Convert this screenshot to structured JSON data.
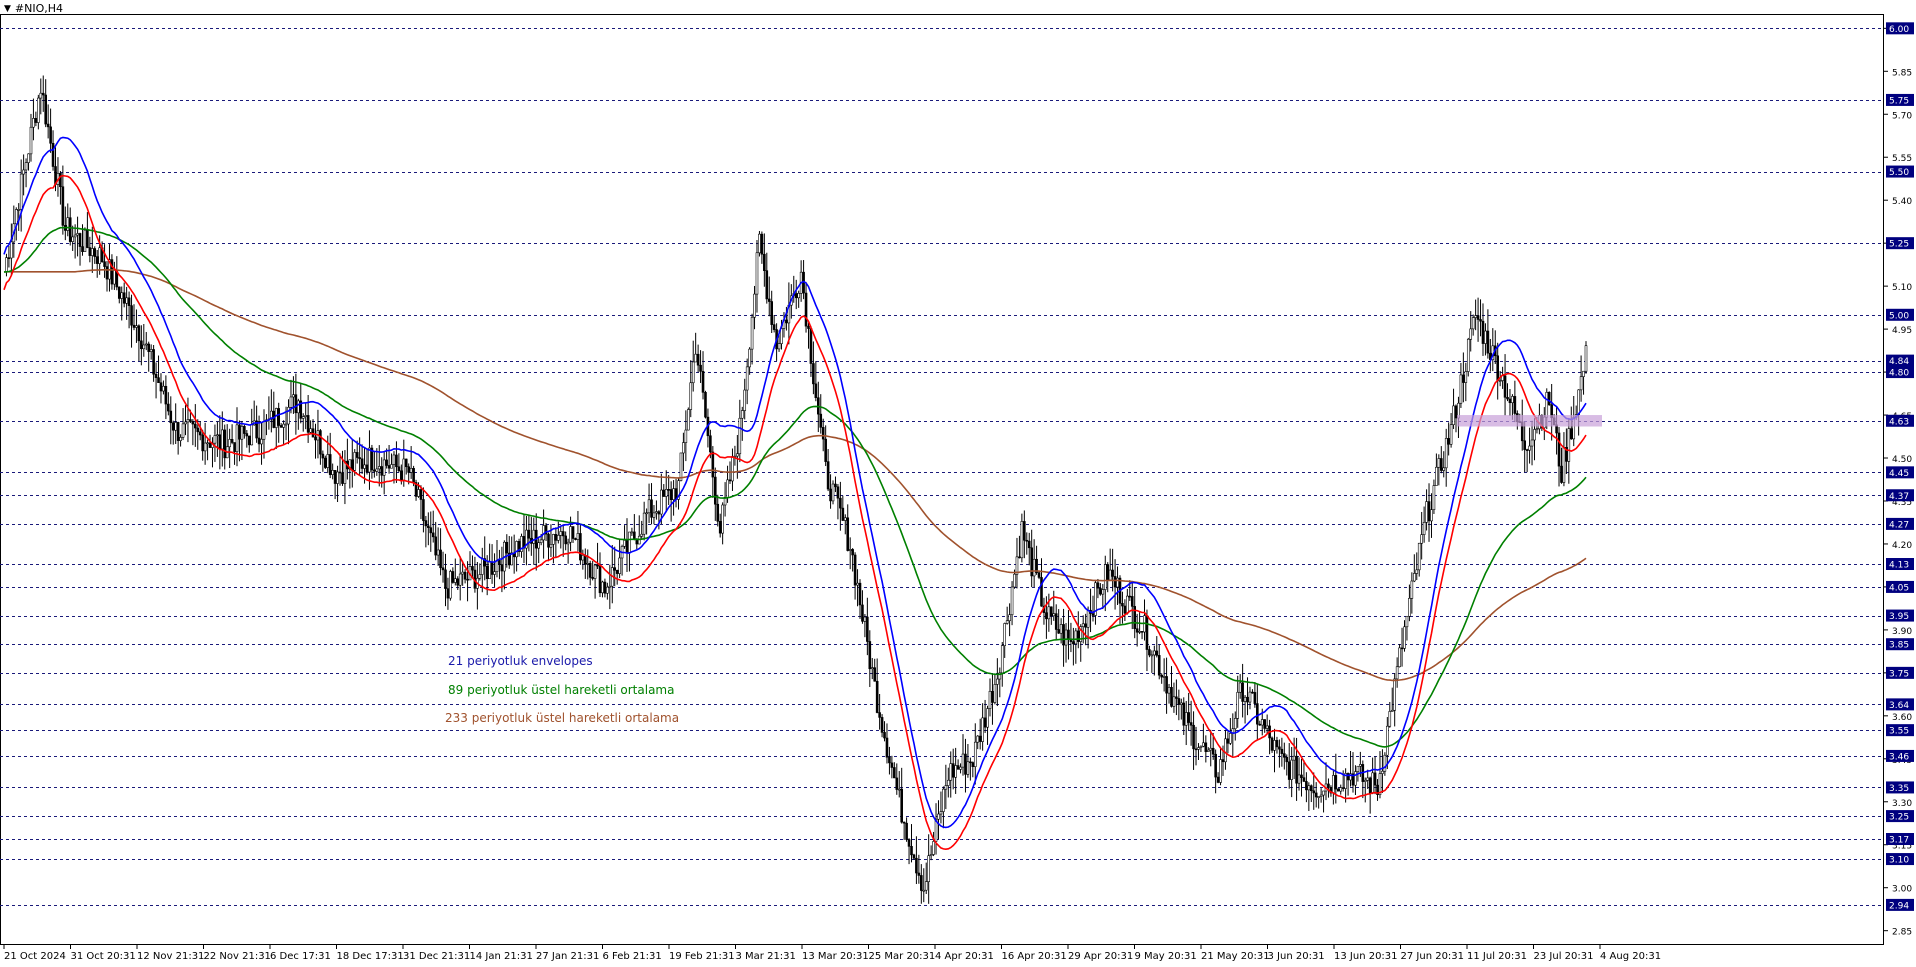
{
  "chart_title": "#NIO,H4",
  "colors": {
    "envelope_upper": "#0000ff",
    "envelope_lower": "#ff0000",
    "ema89": "#008000",
    "ema233": "#a0522d",
    "level_badge_bg": "#00007f",
    "level_badge_text": "#ffffff",
    "zone": "#c8a0d8",
    "candle": "#000000",
    "grid_dash": "#1a1a7a"
  },
  "legend": [
    {
      "label": "21 periyotluk envelopes",
      "color": "#1a1aaa"
    },
    {
      "label": "89 periyotluk üstel hareketli ortalama",
      "color": "#008000"
    },
    {
      "label": "233 periyotluk üstel hareketli ortalama",
      "color": "#a0522d"
    }
  ],
  "chart_data": {
    "type": "line",
    "instrument": "#NIO,H4",
    "ylim": [
      2.8,
      6.05
    ],
    "y_tick_labels": [
      "2.85",
      "3.00",
      "3.15",
      "3.30",
      "3.45",
      "3.60",
      "3.75",
      "3.90",
      "4.05",
      "4.20",
      "4.35",
      "4.50",
      "4.65",
      "4.80",
      "4.95",
      "5.10",
      "5.25",
      "5.40",
      "5.55",
      "5.70",
      "5.85",
      "6.00"
    ],
    "horizontal_levels": [
      "6.00",
      "5.75",
      "5.50",
      "5.25",
      "5.00",
      "4.84",
      "4.80",
      "4.63",
      "4.45",
      "4.37",
      "4.27",
      "4.13",
      "4.05",
      "3.95",
      "3.85",
      "3.75",
      "3.64",
      "3.55",
      "3.46",
      "3.35",
      "3.25",
      "3.17",
      "3.10",
      "2.94"
    ],
    "x_tick_labels": [
      "21 Oct 2024",
      "31 Oct 20:31",
      "12 Nov 21:31",
      "22 Nov 21:31",
      "6 Dec 17:31",
      "18 Dec 17:31",
      "31 Dec 21:31",
      "14 Jan 21:31",
      "27 Jan 21:31",
      "6 Feb 21:31",
      "19 Feb 21:31",
      "3 Mar 21:31",
      "13 Mar 20:31",
      "25 Mar 20:31",
      "4 Apr 20:31",
      "16 Apr 20:31",
      "29 Apr 20:31",
      "9 May 20:31",
      "21 May 20:31",
      "3 Jun 20:31",
      "13 Jun 20:31",
      "27 Jun 20:31",
      "11 Jul 20:31",
      "23 Jul 20:31",
      "4 Aug 20:31"
    ],
    "resistance_zone": [
      4.61,
      4.65
    ],
    "anchors": [
      {
        "i": 0,
        "c": 5.15
      },
      {
        "i": 15,
        "c": 5.8
      },
      {
        "i": 25,
        "c": 5.3
      },
      {
        "i": 40,
        "c": 5.2
      },
      {
        "i": 55,
        "c": 4.95
      },
      {
        "i": 70,
        "c": 4.6
      },
      {
        "i": 90,
        "c": 4.55
      },
      {
        "i": 105,
        "c": 4.6
      },
      {
        "i": 120,
        "c": 4.7
      },
      {
        "i": 135,
        "c": 4.45
      },
      {
        "i": 150,
        "c": 4.5
      },
      {
        "i": 165,
        "c": 4.45
      },
      {
        "i": 180,
        "c": 4.05
      },
      {
        "i": 195,
        "c": 4.1
      },
      {
        "i": 210,
        "c": 4.2
      },
      {
        "i": 230,
        "c": 4.25
      },
      {
        "i": 245,
        "c": 4.05
      },
      {
        "i": 262,
        "c": 4.3
      },
      {
        "i": 275,
        "c": 4.4
      },
      {
        "i": 282,
        "c": 4.9
      },
      {
        "i": 292,
        "c": 4.25
      },
      {
        "i": 300,
        "c": 4.6
      },
      {
        "i": 308,
        "c": 5.25
      },
      {
        "i": 315,
        "c": 4.9
      },
      {
        "i": 325,
        "c": 5.15
      },
      {
        "i": 335,
        "c": 4.45
      },
      {
        "i": 345,
        "c": 4.2
      },
      {
        "i": 355,
        "c": 3.7
      },
      {
        "i": 365,
        "c": 3.3
      },
      {
        "i": 375,
        "c": 3.0
      },
      {
        "i": 385,
        "c": 3.4
      },
      {
        "i": 395,
        "c": 3.45
      },
      {
        "i": 405,
        "c": 3.75
      },
      {
        "i": 415,
        "c": 4.25
      },
      {
        "i": 425,
        "c": 3.95
      },
      {
        "i": 435,
        "c": 3.85
      },
      {
        "i": 450,
        "c": 4.1
      },
      {
        "i": 465,
        "c": 3.9
      },
      {
        "i": 480,
        "c": 3.6
      },
      {
        "i": 495,
        "c": 3.4
      },
      {
        "i": 505,
        "c": 3.7
      },
      {
        "i": 520,
        "c": 3.45
      },
      {
        "i": 535,
        "c": 3.35
      },
      {
        "i": 550,
        "c": 3.4
      },
      {
        "i": 560,
        "c": 3.35
      },
      {
        "i": 570,
        "c": 3.85
      },
      {
        "i": 580,
        "c": 4.3
      },
      {
        "i": 590,
        "c": 4.6
      },
      {
        "i": 600,
        "c": 5.0
      },
      {
        "i": 610,
        "c": 4.8
      },
      {
        "i": 620,
        "c": 4.55
      },
      {
        "i": 630,
        "c": 4.7
      },
      {
        "i": 635,
        "c": 4.45
      },
      {
        "i": 645,
        "c": 4.85
      }
    ]
  }
}
